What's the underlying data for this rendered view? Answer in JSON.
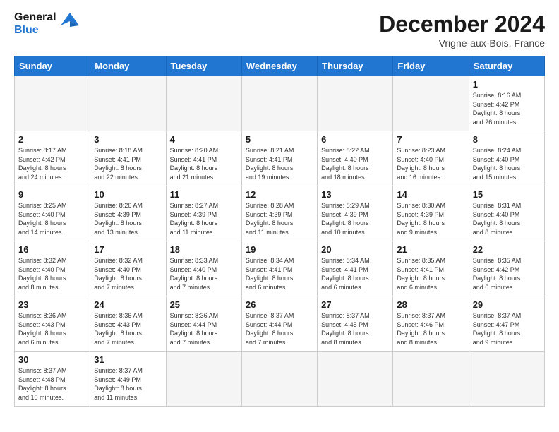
{
  "header": {
    "logo_line1": "General",
    "logo_line2": "Blue",
    "month": "December 2024",
    "location": "Vrigne-aux-Bois, France"
  },
  "weekdays": [
    "Sunday",
    "Monday",
    "Tuesday",
    "Wednesday",
    "Thursday",
    "Friday",
    "Saturday"
  ],
  "days": [
    {
      "num": "",
      "info": ""
    },
    {
      "num": "",
      "info": ""
    },
    {
      "num": "",
      "info": ""
    },
    {
      "num": "",
      "info": ""
    },
    {
      "num": "",
      "info": ""
    },
    {
      "num": "",
      "info": ""
    },
    {
      "num": "1",
      "info": "Sunrise: 8:16 AM\nSunset: 4:42 PM\nDaylight: 8 hours\nand 26 minutes."
    },
    {
      "num": "2",
      "info": "Sunrise: 8:17 AM\nSunset: 4:42 PM\nDaylight: 8 hours\nand 24 minutes."
    },
    {
      "num": "3",
      "info": "Sunrise: 8:18 AM\nSunset: 4:41 PM\nDaylight: 8 hours\nand 22 minutes."
    },
    {
      "num": "4",
      "info": "Sunrise: 8:20 AM\nSunset: 4:41 PM\nDaylight: 8 hours\nand 21 minutes."
    },
    {
      "num": "5",
      "info": "Sunrise: 8:21 AM\nSunset: 4:41 PM\nDaylight: 8 hours\nand 19 minutes."
    },
    {
      "num": "6",
      "info": "Sunrise: 8:22 AM\nSunset: 4:40 PM\nDaylight: 8 hours\nand 18 minutes."
    },
    {
      "num": "7",
      "info": "Sunrise: 8:23 AM\nSunset: 4:40 PM\nDaylight: 8 hours\nand 16 minutes."
    },
    {
      "num": "8",
      "info": "Sunrise: 8:24 AM\nSunset: 4:40 PM\nDaylight: 8 hours\nand 15 minutes."
    },
    {
      "num": "9",
      "info": "Sunrise: 8:25 AM\nSunset: 4:40 PM\nDaylight: 8 hours\nand 14 minutes."
    },
    {
      "num": "10",
      "info": "Sunrise: 8:26 AM\nSunset: 4:39 PM\nDaylight: 8 hours\nand 13 minutes."
    },
    {
      "num": "11",
      "info": "Sunrise: 8:27 AM\nSunset: 4:39 PM\nDaylight: 8 hours\nand 11 minutes."
    },
    {
      "num": "12",
      "info": "Sunrise: 8:28 AM\nSunset: 4:39 PM\nDaylight: 8 hours\nand 11 minutes."
    },
    {
      "num": "13",
      "info": "Sunrise: 8:29 AM\nSunset: 4:39 PM\nDaylight: 8 hours\nand 10 minutes."
    },
    {
      "num": "14",
      "info": "Sunrise: 8:30 AM\nSunset: 4:39 PM\nDaylight: 8 hours\nand 9 minutes."
    },
    {
      "num": "15",
      "info": "Sunrise: 8:31 AM\nSunset: 4:40 PM\nDaylight: 8 hours\nand 8 minutes."
    },
    {
      "num": "16",
      "info": "Sunrise: 8:32 AM\nSunset: 4:40 PM\nDaylight: 8 hours\nand 8 minutes."
    },
    {
      "num": "17",
      "info": "Sunrise: 8:32 AM\nSunset: 4:40 PM\nDaylight: 8 hours\nand 7 minutes."
    },
    {
      "num": "18",
      "info": "Sunrise: 8:33 AM\nSunset: 4:40 PM\nDaylight: 8 hours\nand 7 minutes."
    },
    {
      "num": "19",
      "info": "Sunrise: 8:34 AM\nSunset: 4:41 PM\nDaylight: 8 hours\nand 6 minutes."
    },
    {
      "num": "20",
      "info": "Sunrise: 8:34 AM\nSunset: 4:41 PM\nDaylight: 8 hours\nand 6 minutes."
    },
    {
      "num": "21",
      "info": "Sunrise: 8:35 AM\nSunset: 4:41 PM\nDaylight: 8 hours\nand 6 minutes."
    },
    {
      "num": "22",
      "info": "Sunrise: 8:35 AM\nSunset: 4:42 PM\nDaylight: 8 hours\nand 6 minutes."
    },
    {
      "num": "23",
      "info": "Sunrise: 8:36 AM\nSunset: 4:43 PM\nDaylight: 8 hours\nand 6 minutes."
    },
    {
      "num": "24",
      "info": "Sunrise: 8:36 AM\nSunset: 4:43 PM\nDaylight: 8 hours\nand 7 minutes."
    },
    {
      "num": "25",
      "info": "Sunrise: 8:36 AM\nSunset: 4:44 PM\nDaylight: 8 hours\nand 7 minutes."
    },
    {
      "num": "26",
      "info": "Sunrise: 8:37 AM\nSunset: 4:44 PM\nDaylight: 8 hours\nand 7 minutes."
    },
    {
      "num": "27",
      "info": "Sunrise: 8:37 AM\nSunset: 4:45 PM\nDaylight: 8 hours\nand 8 minutes."
    },
    {
      "num": "28",
      "info": "Sunrise: 8:37 AM\nSunset: 4:46 PM\nDaylight: 8 hours\nand 8 minutes."
    },
    {
      "num": "29",
      "info": "Sunrise: 8:37 AM\nSunset: 4:47 PM\nDaylight: 8 hours\nand 9 minutes."
    },
    {
      "num": "30",
      "info": "Sunrise: 8:37 AM\nSunset: 4:48 PM\nDaylight: 8 hours\nand 10 minutes."
    },
    {
      "num": "31",
      "info": "Sunrise: 8:37 AM\nSunset: 4:49 PM\nDaylight: 8 hours\nand 11 minutes."
    },
    {
      "num": "",
      "info": ""
    },
    {
      "num": "",
      "info": ""
    },
    {
      "num": "",
      "info": ""
    },
    {
      "num": "",
      "info": ""
    },
    {
      "num": "",
      "info": ""
    }
  ]
}
